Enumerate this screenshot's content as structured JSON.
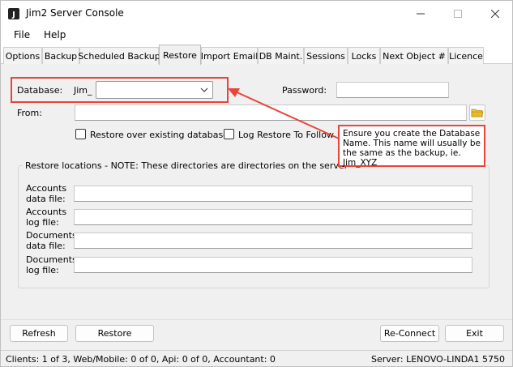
{
  "window": {
    "title": "Jim2 Server Console",
    "minimize_icon": "minimize-icon",
    "maximize_icon": "maximize-icon",
    "close_icon": "close-icon"
  },
  "menu": [
    "File",
    "Help"
  ],
  "tabs": [
    "Options",
    "Backup",
    "Scheduled Backup",
    "Restore",
    "Import Email",
    "DB Maint.",
    "Sessions",
    "Locks",
    "Next Object #",
    "Licence"
  ],
  "active_tab": "Restore",
  "restore": {
    "database_label": "Database:",
    "database_prefix": "Jim_",
    "database_value": "",
    "password_label": "Password:",
    "password_value": "",
    "from_label": "From:",
    "from_value": "",
    "restore_over_label": "Restore over existing database",
    "log_restore_label": "Log Restore To Follow"
  },
  "callout": {
    "text": "Ensure you create the Database Name. This name will usually be the same as the backup, ie. Jim_XYZ"
  },
  "locations": {
    "legend": "Restore locations - NOTE: These directories are directories on the server",
    "accounts_data_line1": "Accounts",
    "accounts_data_line2": "data file:",
    "accounts_log_line1": "Accounts",
    "accounts_log_line2": "log file:",
    "documents_data_line1": "Documents",
    "documents_data_line2": "data file:",
    "documents_log_line1": "Documents",
    "documents_log_line2": "log file:"
  },
  "buttons": {
    "refresh": "Refresh",
    "restore": "Restore",
    "reconnect": "Re-Connect",
    "exit": "Exit"
  },
  "status": {
    "left": "Clients: 1 of 3, Web/Mobile: 0 of 0, Api: 0 of 0, Accountant: 0",
    "right": "Server: LENOVO-LINDA1 5750"
  },
  "colors": {
    "annotation_red": "#e8443a",
    "folder_yellow": "#e8b923"
  }
}
